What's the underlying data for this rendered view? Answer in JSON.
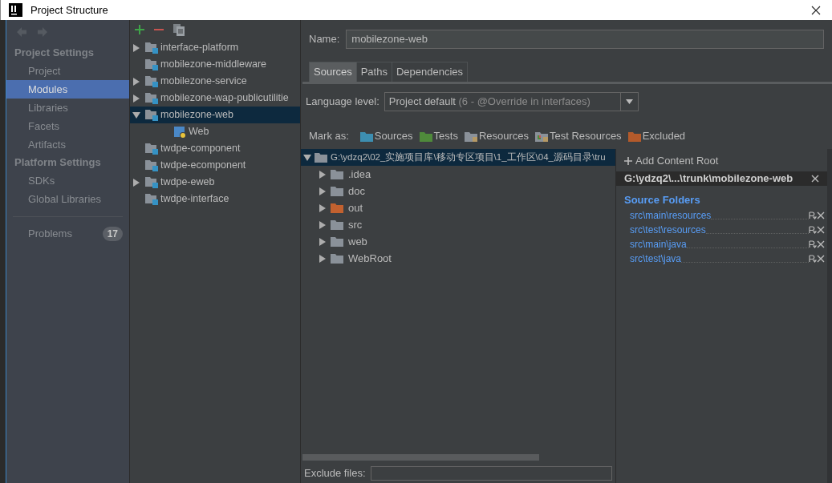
{
  "window": {
    "title": "Project Structure"
  },
  "sidebar": {
    "sections": [
      {
        "heading": "Project Settings",
        "items": [
          {
            "label": "Project",
            "selected": false
          },
          {
            "label": "Modules",
            "selected": true
          },
          {
            "label": "Libraries",
            "selected": false
          },
          {
            "label": "Facets",
            "selected": false
          },
          {
            "label": "Artifacts",
            "selected": false
          }
        ]
      },
      {
        "heading": "Platform Settings",
        "items": [
          {
            "label": "SDKs",
            "selected": false
          },
          {
            "label": "Global Libraries",
            "selected": false
          }
        ]
      }
    ],
    "problems": {
      "label": "Problems",
      "count": "17"
    }
  },
  "modules": [
    {
      "name": "interface-platform",
      "expanded": false,
      "selected": false
    },
    {
      "name": "mobilezone-middleware",
      "selected": false
    },
    {
      "name": "mobilezone-service",
      "expanded": false,
      "selected": false
    },
    {
      "name": "mobilezone-wap-publicutilitie",
      "expanded": false,
      "selected": false
    },
    {
      "name": "mobilezone-web",
      "expanded": true,
      "selected": true,
      "children": [
        {
          "name": "Web",
          "selected": false,
          "kind": "facet"
        }
      ]
    },
    {
      "name": "twdpe-component",
      "selected": false
    },
    {
      "name": "twdpe-ecomponent",
      "selected": false
    },
    {
      "name": "twdpe-eweb",
      "expanded": false,
      "selected": false
    },
    {
      "name": "twdpe-interface",
      "selected": false
    }
  ],
  "name_field": {
    "label": "Name:",
    "value": "mobilezone-web"
  },
  "tabs": [
    {
      "label": "Sources",
      "selected": true
    },
    {
      "label": "Paths",
      "selected": false
    },
    {
      "label": "Dependencies",
      "selected": false
    }
  ],
  "language_level": {
    "label": "Language level:",
    "value": "Project default",
    "detail": "(6 - @Override in interfaces)"
  },
  "mark_as": {
    "label": "Mark as:",
    "options": [
      {
        "label": "Sources",
        "color": "#3d8eb0",
        "kind": "plain"
      },
      {
        "label": "Tests",
        "color": "#4f8a3b",
        "kind": "plain"
      },
      {
        "label": "Resources",
        "color": "#8a9199",
        "kind": "resource"
      },
      {
        "label": "Test Resources",
        "color": "#8a9199",
        "kind": "test-resource"
      },
      {
        "label": "Excluded",
        "color": "#b35a2b",
        "kind": "plain"
      }
    ]
  },
  "content_tree": {
    "path": "G:\\ydzq2\\02_实施项目库\\移动专区项目\\1_工作区\\04_源码目录\\tru",
    "expanded": true,
    "selected": true,
    "children": [
      {
        "name": ".idea",
        "color": "#8a9199"
      },
      {
        "name": "doc",
        "color": "#8a9199"
      },
      {
        "name": "out",
        "color": "#c2612f"
      },
      {
        "name": "src",
        "color": "#8a9199"
      },
      {
        "name": "web",
        "color": "#8a9199"
      },
      {
        "name": "WebRoot",
        "color": "#8a9199"
      }
    ]
  },
  "content_root": {
    "add_label": "Add Content Root",
    "root_path": "G:\\ydzq2\\...\\trunk\\mobilezone-web",
    "section_title": "Source Folders",
    "folders": [
      "src\\main\\resources",
      "src\\test\\resources",
      "src\\main\\java",
      "src\\test\\java"
    ]
  },
  "exclude": {
    "label": "Exclude files:"
  }
}
